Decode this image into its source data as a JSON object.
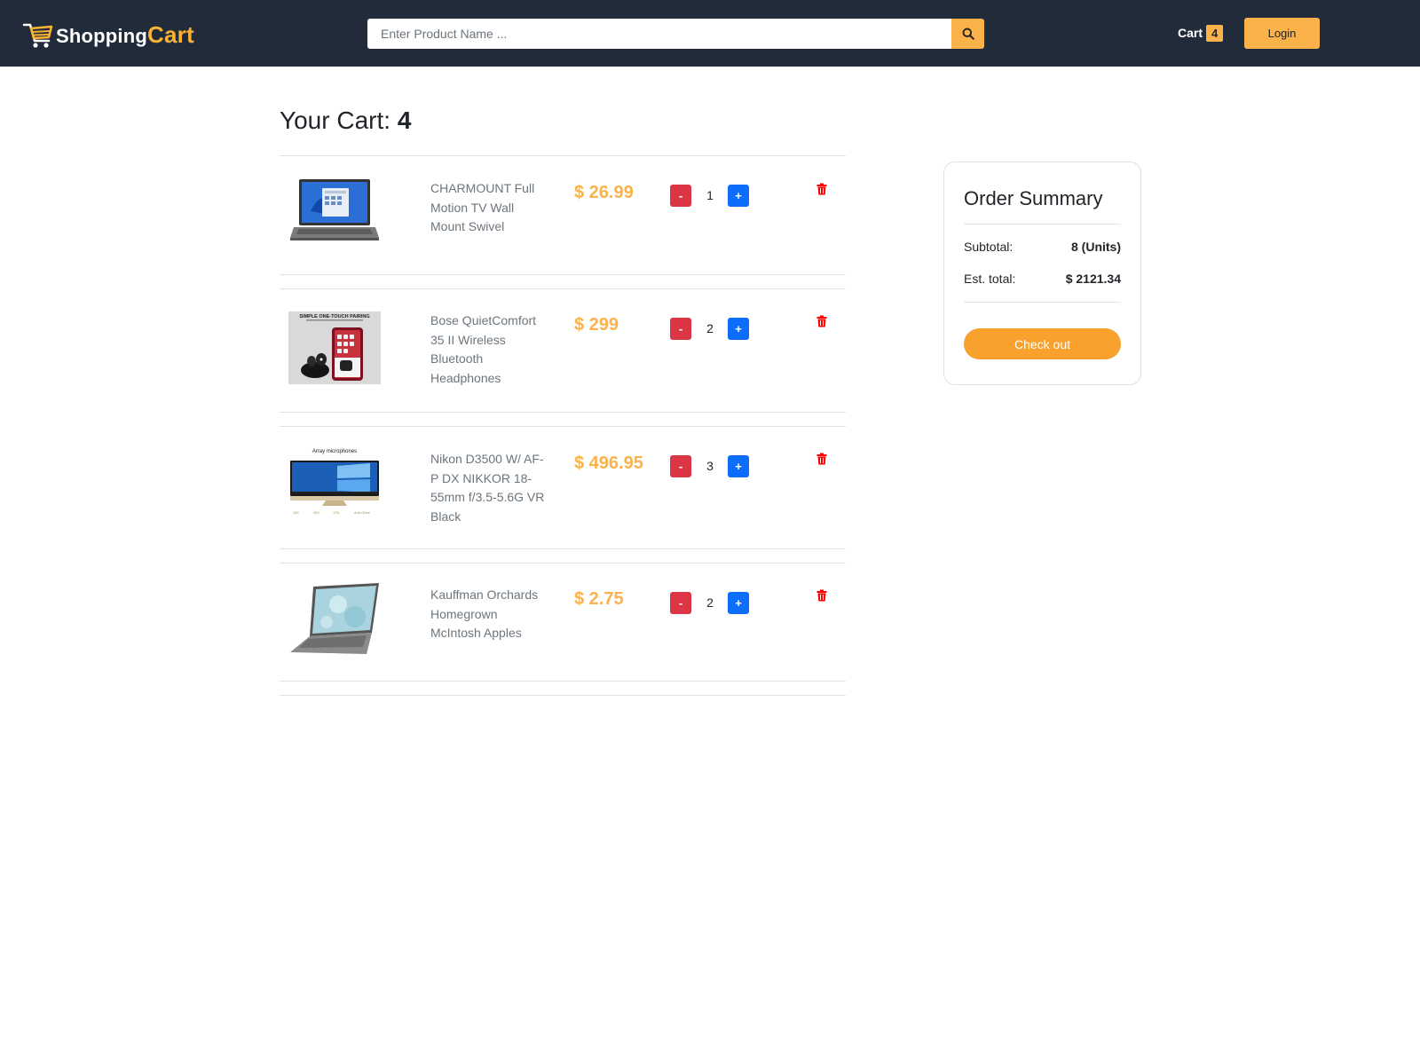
{
  "header": {
    "brand_part1": "Shopping",
    "brand_part2": "Cart",
    "search_placeholder": "Enter Product Name ...",
    "cart_label": "Cart",
    "cart_count": "4",
    "login_label": "Login"
  },
  "cart": {
    "title_label": "Your Cart:",
    "title_count": "4",
    "items": [
      {
        "name": "CHARMOUNT Full Motion TV Wall Mount Swivel",
        "price": "$ 26.99",
        "qty": "1",
        "minus": "-",
        "plus": "+",
        "image_icon": "laptop-windows11-icon"
      },
      {
        "name": "Bose QuietComfort 35 II Wireless Bluetooth Headphones",
        "price": "$ 299",
        "qty": "2",
        "minus": "-",
        "plus": "+",
        "image_icon": "earbuds-phone-icon",
        "image_caption": "SIMPLE ONE-TOUCH PAIRING"
      },
      {
        "name": "Nikon D3500 W/ AF-P DX NIKKOR 18-55mm f/3.5-5.6G VR Black",
        "price": "$ 496.95",
        "qty": "3",
        "minus": "-",
        "plus": "+",
        "image_icon": "all-in-one-pc-icon",
        "image_caption": "Array microphones"
      },
      {
        "name": "Kauffman Orchards Homegrown McIntosh Apples",
        "price": "$ 2.75",
        "qty": "2",
        "minus": "-",
        "plus": "+",
        "image_icon": "laptop-icon"
      }
    ]
  },
  "summary": {
    "title": "Order Summary",
    "subtotal_label": "Subtotal:",
    "subtotal_value": "8 (Units)",
    "total_label": "Est. total:",
    "total_value": "$ 2121.34",
    "checkout_label": "Check out"
  },
  "colors": {
    "navbar": "#222b3a",
    "accent": "#fbb24a",
    "minus": "#dc3545",
    "plus": "#0d6efd",
    "trash": "#ff0000"
  }
}
